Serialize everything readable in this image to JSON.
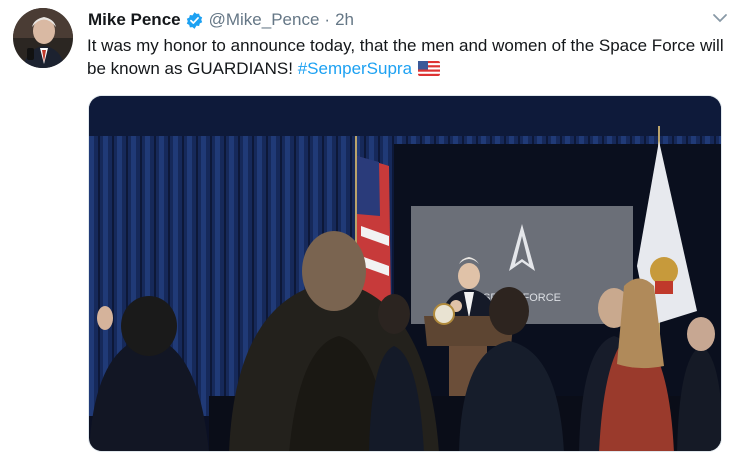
{
  "tweet": {
    "name": "Mike Pence",
    "handle": "@Mike_Pence",
    "separator": "·",
    "time": "2h",
    "text_main": "It was my honor to announce today, that the men and women of the Space Force will be known as GUARDIANS!",
    "hashtag": "#SemperSupra",
    "emoji": "us-flag-emoji",
    "verified_icon": "verified-badge-icon",
    "menu_icon": "chevron-down-icon"
  },
  "media": {
    "screen_logo_text": "SPACE FORCE",
    "colors": {
      "curtain": "#1a2a55",
      "screen": "#6b6f78"
    }
  },
  "colors": {
    "link": "#1da1f2",
    "secondary": "#657786",
    "text": "#14171a"
  }
}
